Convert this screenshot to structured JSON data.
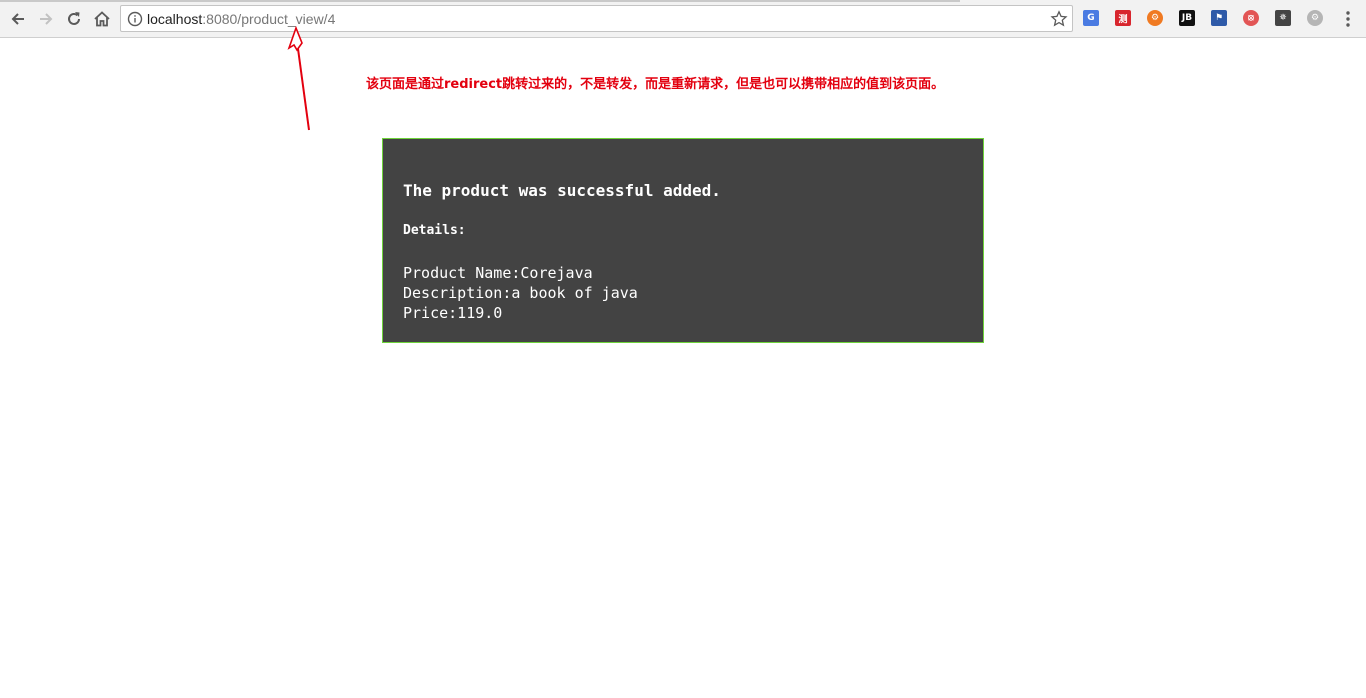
{
  "browser": {
    "url_host": "localhost",
    "url_rest": ":8080/product_view/4",
    "icons": [
      "back-icon",
      "forward-icon",
      "reload-icon",
      "home-icon",
      "info-icon",
      "bookmark-star-icon"
    ],
    "extensions": [
      {
        "name": "google-translate-extension-icon",
        "color": "#4a7be2",
        "glyph": "G"
      },
      {
        "name": "red-square-extension-icon",
        "color": "#d8262e",
        "glyph": "测"
      },
      {
        "name": "orange-circle-extension-icon",
        "color": "#f07a22",
        "glyph": "⚙"
      },
      {
        "name": "jetbrains-extension-icon",
        "color": "#111111",
        "glyph": "JB"
      },
      {
        "name": "blue-bookmark-extension-icon",
        "color": "#2e5aa8",
        "glyph": "⚑"
      },
      {
        "name": "red-circle-extension-icon",
        "color": "#e25555",
        "glyph": "⦻"
      },
      {
        "name": "bug-extension-icon",
        "color": "#444444",
        "glyph": "✵"
      },
      {
        "name": "gray-gear-extension-icon",
        "color": "#b5b5b5",
        "glyph": "⚙"
      }
    ]
  },
  "annotation": {
    "text": "该页面是通过redirect跳转过来的，不是转发，而是重新请求，但是也可以携带相应的值到该页面。",
    "color": "#e3000f"
  },
  "panel": {
    "heading": "The product was successful added.",
    "details_label": "Details:",
    "lines": [
      "Product Name:Corejava",
      "Description:a book of java",
      "Price:119.0"
    ],
    "colors": {
      "background": "#434343",
      "border": "#6ed33a"
    }
  }
}
